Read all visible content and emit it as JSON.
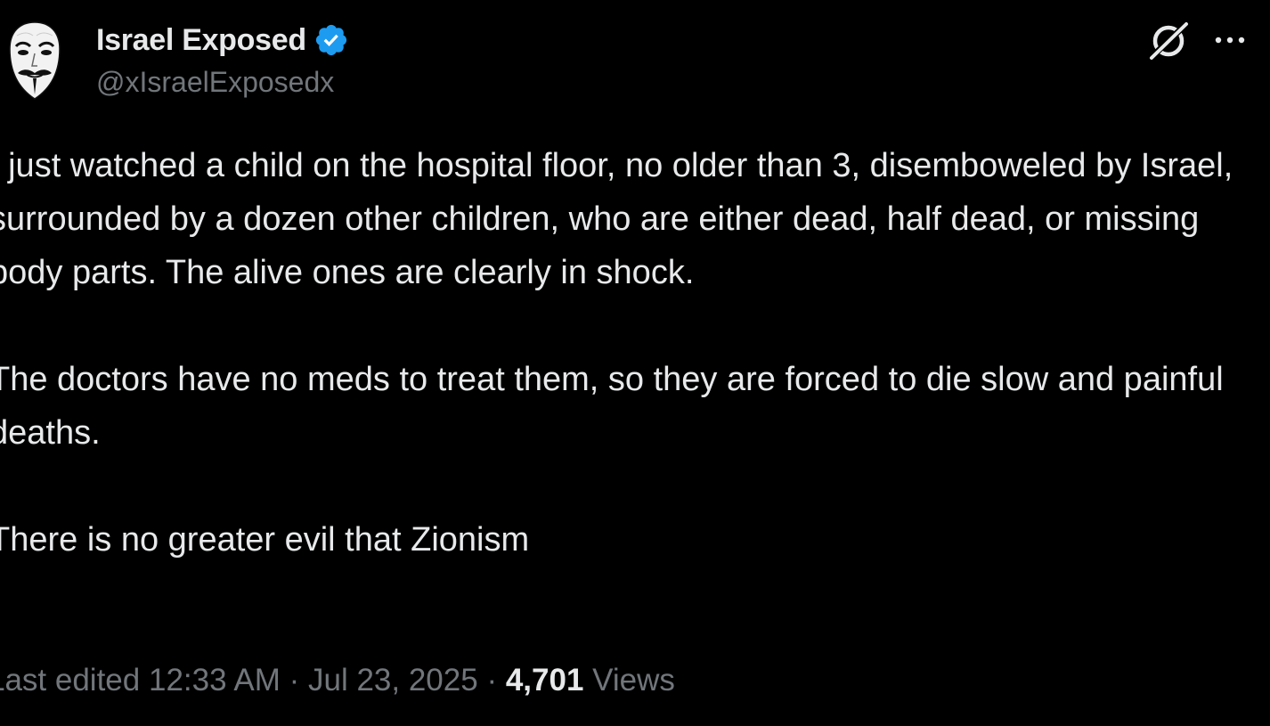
{
  "author": {
    "display_name": "Israel Exposed",
    "handle": "@xIsraelExposedx",
    "verified": true,
    "verified_color": "#1d9bf0",
    "avatar_icon": "guy-fawkes-mask-icon"
  },
  "header_actions": {
    "grok_icon": "grok-icon",
    "more_icon": "more-horizontal-icon"
  },
  "tweet": {
    "paragraphs": [
      "I just watched a child on the hospital floor, no older than 3, disemboweled by Israel, surrounded by a dozen other children, who are either dead, half dead, or missing body parts. The alive ones are clearly in shock.",
      "The doctors have no meds to treat them, so they are forced to die slow and painful deaths.",
      "There is no greater evil that Zionism"
    ]
  },
  "meta": {
    "edited_label": "Last edited",
    "time": "12:33 AM",
    "separator": "·",
    "date": "Jul 23, 2025",
    "views_count": "4,701",
    "views_label": "Views"
  },
  "colors": {
    "background": "#000000",
    "primary_text": "#e7e9ea",
    "secondary_text": "#71767b"
  }
}
